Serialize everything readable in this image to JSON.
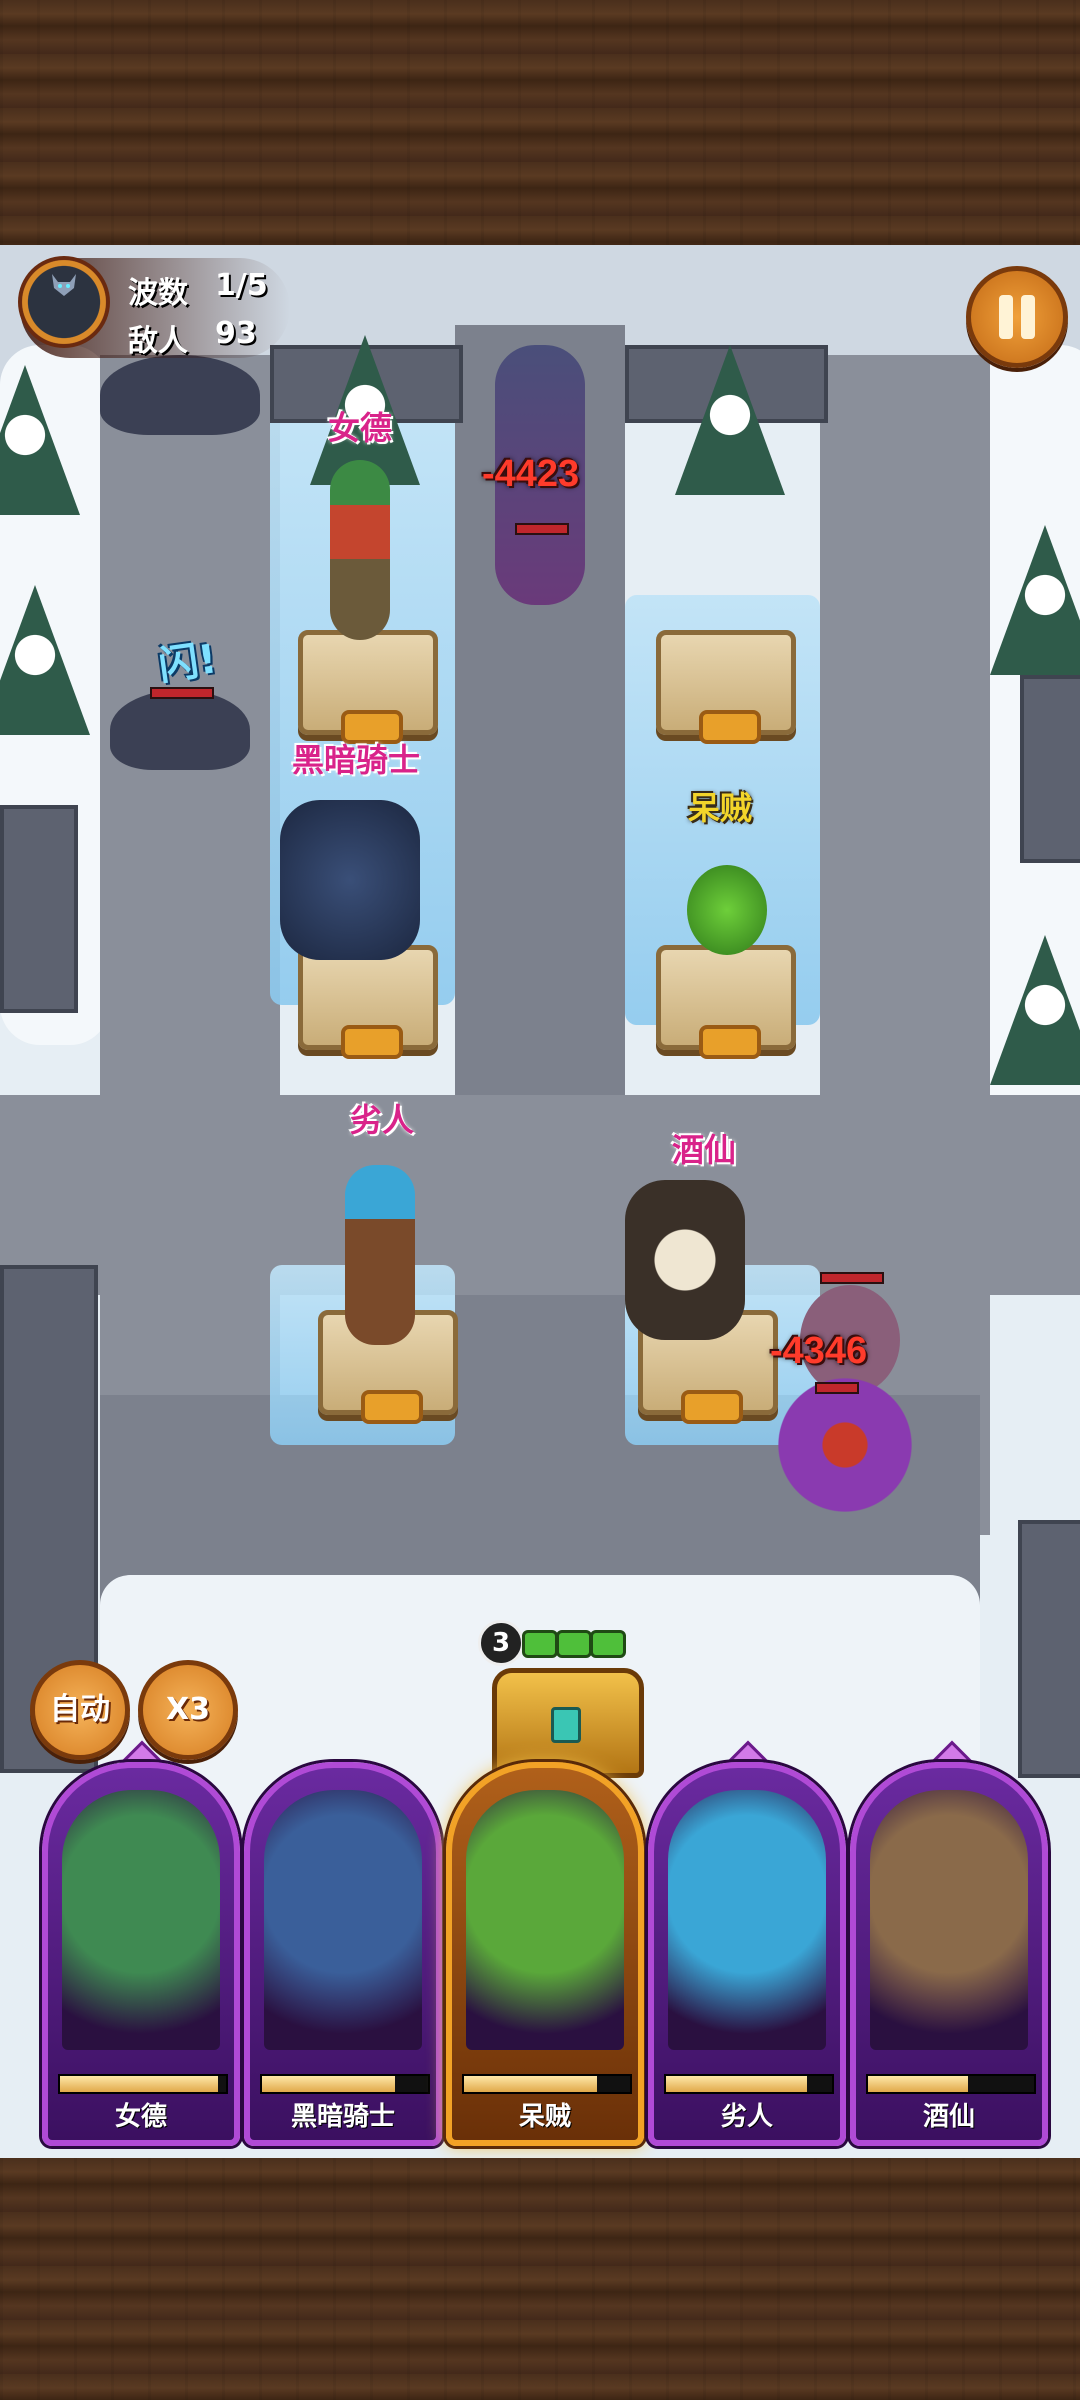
{
  "hud": {
    "wave_label": "波数",
    "wave_value": "1/5",
    "enemy_label": "敌人",
    "enemy_value": "93"
  },
  "field": {
    "hero_names": {
      "nvde": "女德",
      "dark_knight": "黑暗骑士",
      "daizei": "呆贼",
      "lieren": "劣人",
      "jiuxian": "酒仙"
    },
    "damage_numbers": [
      "-4423",
      "-4346"
    ],
    "dodge_text": "闪!"
  },
  "controls": {
    "auto_label": "自动",
    "speed_label": "X3"
  },
  "wave_progress": {
    "number": "3",
    "segments_filled": 3,
    "segments_total": 3
  },
  "hero_cards": [
    {
      "label": "女德",
      "energy": 0.95,
      "selected": false,
      "color": "#3f8a52"
    },
    {
      "label": "黑暗骑士",
      "energy": 0.8,
      "selected": false,
      "color": "#3a5f9a"
    },
    {
      "label": "呆贼",
      "energy": 0.8,
      "selected": true,
      "color": "#5aa83a"
    },
    {
      "label": "劣人",
      "energy": 0.85,
      "selected": false,
      "color": "#3aa6d6"
    },
    {
      "label": "酒仙",
      "energy": 0.6,
      "selected": false,
      "color": "#8a6a4a"
    }
  ],
  "colors": {
    "card_border": "#b04ad6",
    "selected_border": "#f2a226",
    "damage": "#ff3b2b",
    "name_pink": "#d9238a",
    "name_yellow": "#f3d52a"
  }
}
